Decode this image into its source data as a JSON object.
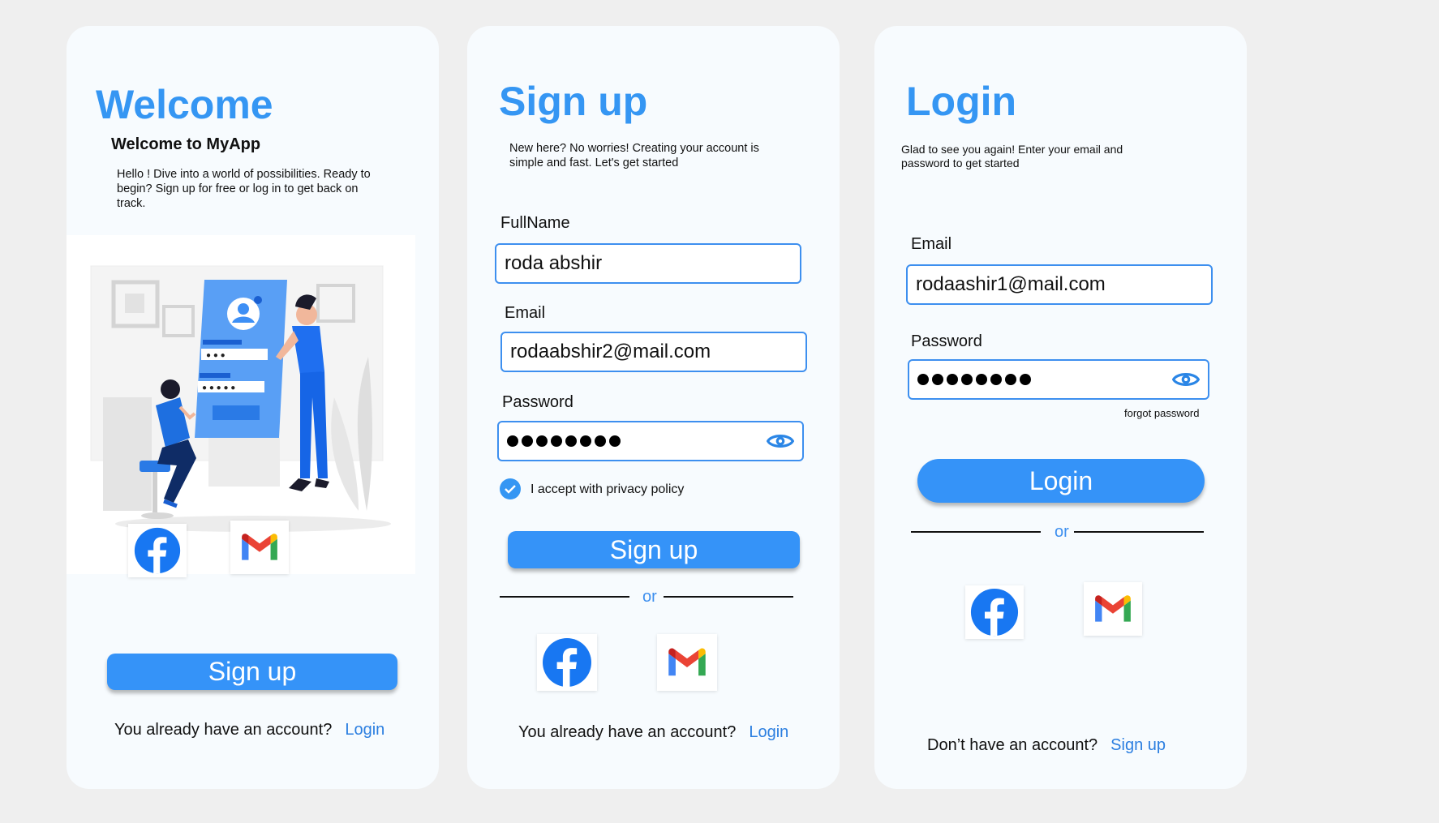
{
  "welcome": {
    "title": "Welcome",
    "subtitle": "Welcome to MyApp",
    "description": "Hello ! Dive into a world of possibilities. Ready to begin? Sign up for free or log in to get back on track.",
    "signup_button": "Sign up",
    "footer_text": "You already have an account?",
    "footer_link": "Login"
  },
  "signup": {
    "title": "Sign up",
    "description": "New here? No worries! Creating your account is simple and fast. Let's get started",
    "fullname_label": "FullName",
    "fullname_value": "roda abshir",
    "email_label": "Email",
    "email_value": "rodaabshir2@mail.com",
    "password_label": "Password",
    "password_dot_count": 8,
    "privacy_label": "I accept with privacy policy",
    "privacy_checked": true,
    "signup_button": "Sign up",
    "or_text": "or",
    "footer_text": "You already have an account?",
    "footer_link": "Login"
  },
  "login": {
    "title": "Login",
    "description": "Glad to see you again! Enter your email and password to get started",
    "email_label": "Email",
    "email_value": "rodaashir1@mail.com",
    "password_label": "Password",
    "password_dot_count": 8,
    "forgot_password": "forgot password",
    "login_button": "Login",
    "or_text": "or",
    "footer_text": "Don’t  have an account?",
    "footer_link": "Sign up"
  },
  "colors": {
    "accent": "#3596f3",
    "button": "#3593f8",
    "page_background": "#efefef",
    "card_background": "#f7fbfe"
  },
  "icons": [
    "facebook-icon",
    "gmail-icon",
    "eye-icon",
    "checkmark-icon"
  ]
}
